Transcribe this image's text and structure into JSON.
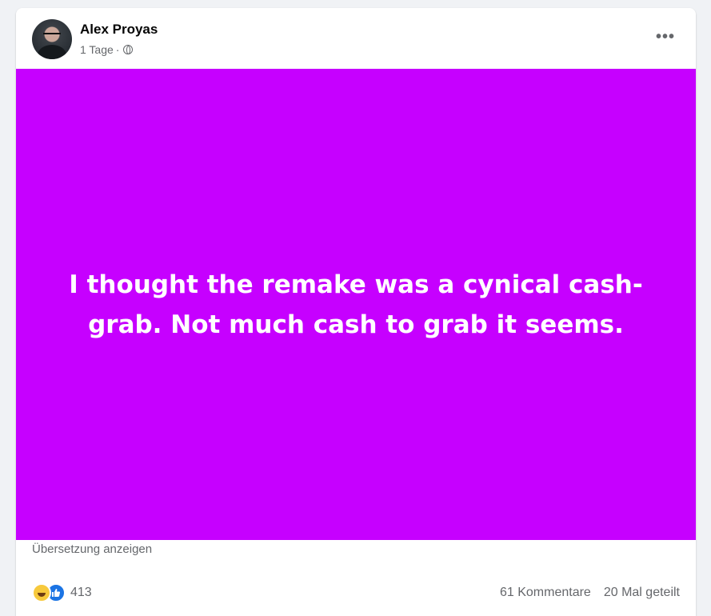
{
  "post": {
    "author": "Alex Proyas",
    "time": "1 Tage",
    "separator": "·",
    "privacy_icon": "globe-icon",
    "more_icon": "more-options-icon",
    "text": "I thought the remake was a cynical cash-grab. Not much cash to grab it seems.",
    "background_color": "#c600ff",
    "translate_label": "Übersetzung anzeigen"
  },
  "footer": {
    "reaction_icons": [
      "haha-icon",
      "like-icon"
    ],
    "reaction_count": "413",
    "comments": "61 Kommentare",
    "shares": "20 Mal geteilt"
  }
}
